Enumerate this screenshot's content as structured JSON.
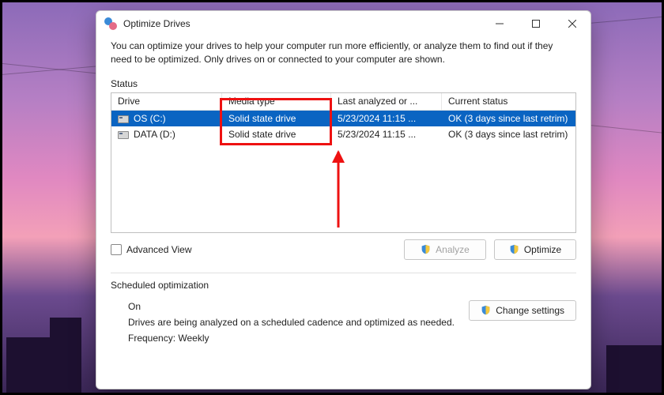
{
  "window": {
    "title": "Optimize Drives",
    "intro": "You can optimize your drives to help your computer run more efficiently, or analyze them to find out if they need to be optimized. Only drives on or connected to your computer are shown."
  },
  "status": {
    "label": "Status",
    "columns": {
      "drive": "Drive",
      "media": "Media type",
      "last": "Last analyzed or ...",
      "status": "Current status"
    },
    "rows": [
      {
        "drive": "OS (C:)",
        "media": "Solid state drive",
        "last": "5/23/2024 11:15 ...",
        "status": "OK (3 days since last retrim)",
        "selected": true
      },
      {
        "drive": "DATA (D:)",
        "media": "Solid state drive",
        "last": "5/23/2024 11:15 ...",
        "status": "OK (3 days since last retrim)",
        "selected": false
      }
    ]
  },
  "advanced_view_label": "Advanced View",
  "buttons": {
    "analyze": "Analyze",
    "optimize": "Optimize",
    "change_settings": "Change settings"
  },
  "scheduled": {
    "label": "Scheduled optimization",
    "state": "On",
    "desc": "Drives are being analyzed on a scheduled cadence and optimized as needed.",
    "freq": "Frequency: Weekly"
  },
  "annotation": {
    "color": "#e11"
  }
}
